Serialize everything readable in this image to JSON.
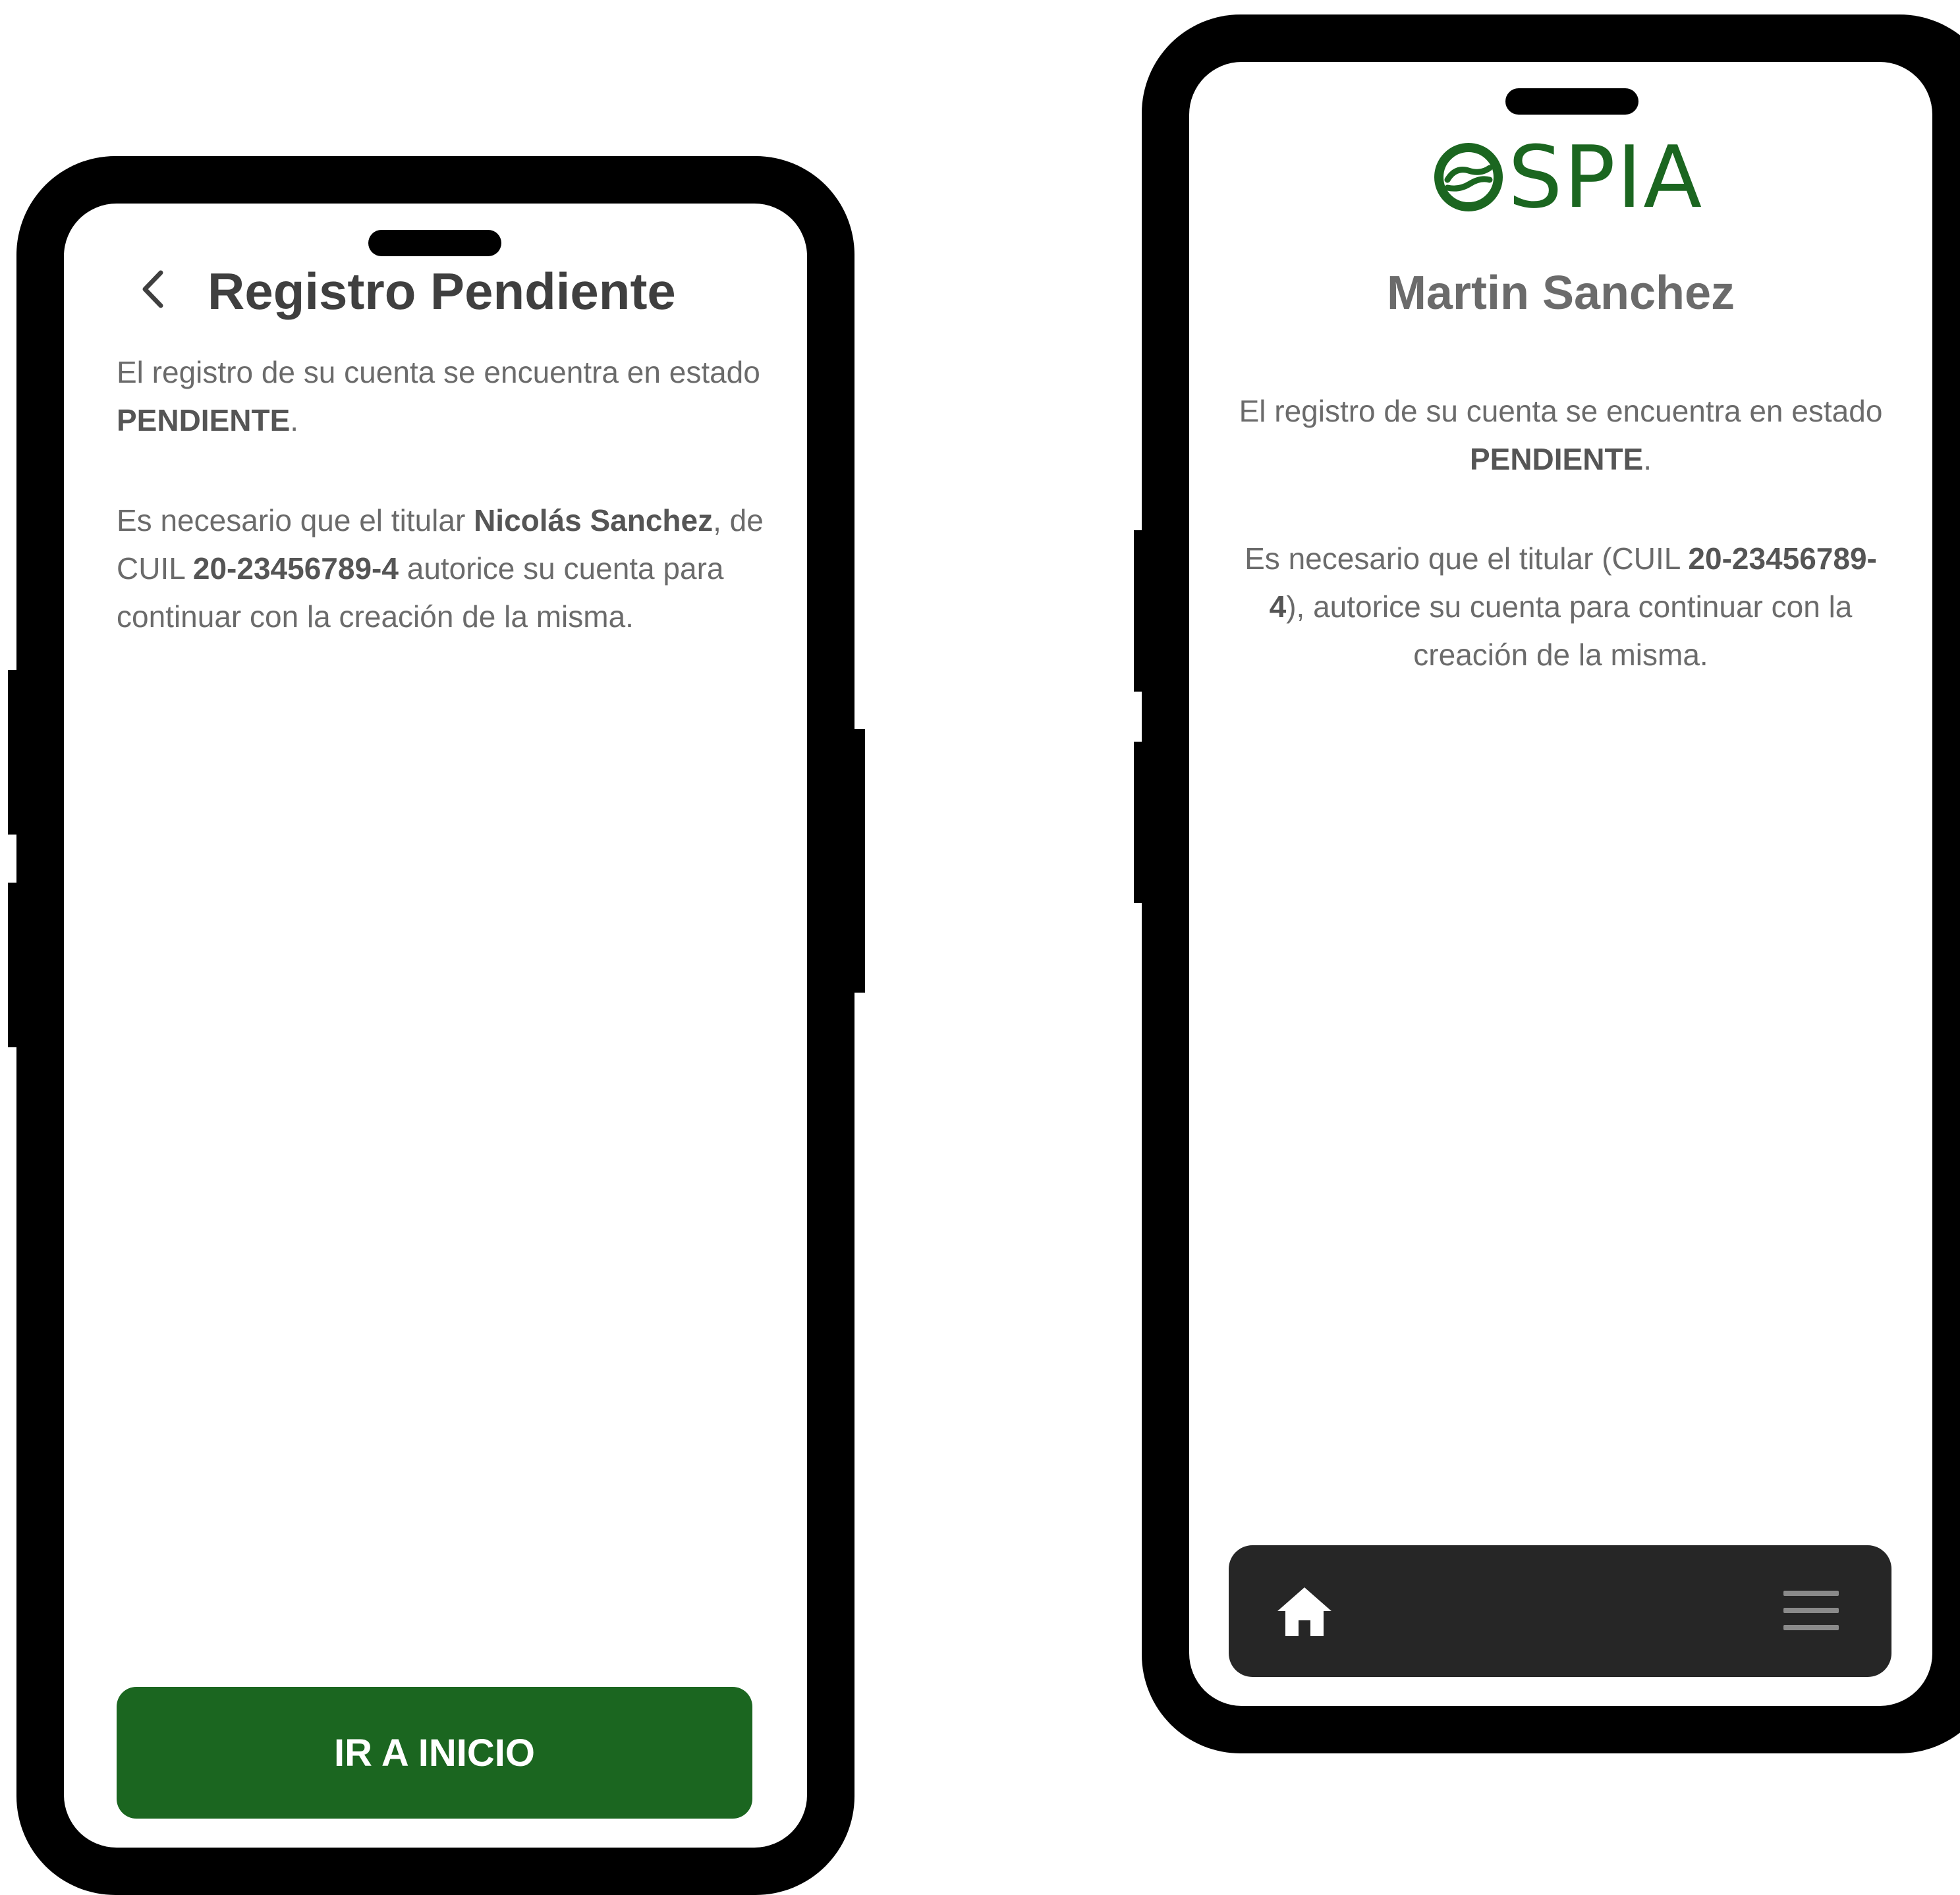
{
  "left_screen": {
    "header": {
      "title": "Registro Pendiente",
      "back_icon": "chevron-left-icon"
    },
    "status_message": {
      "prefix": "El registro de su cuenta se encuentra en estado ",
      "status": "PENDIENTE",
      "suffix": "."
    },
    "authorization_message": {
      "prefix": "Es necesario que el titular ",
      "holder_name": "Nicolás Sanchez",
      "middle": ", de CUIL ",
      "cuil": "20-23456789-4",
      "suffix": " autorice su cuenta para continuar con la creación de la misma."
    },
    "primary_button_label": "IR A INICIO"
  },
  "right_screen": {
    "logo_text": "SPIA",
    "user_name": "Martin Sanchez",
    "status_message": {
      "prefix": "El registro de su cuenta se encuentra en estado ",
      "status": "PENDIENTE",
      "suffix": "."
    },
    "authorization_message": {
      "prefix": "Es necesario que el titular (CUIL ",
      "cuil": "20-23456789-4",
      "suffix": "), autorice su cuenta para continuar con la creación de la misma."
    },
    "bottom_nav": {
      "home_icon": "home-icon",
      "menu_icon": "hamburger-menu-icon"
    }
  },
  "colors": {
    "brand_green": "#1b6620",
    "text_dark": "#3f3f3f",
    "text_body": "#6b6b6b",
    "nav_background": "#262626",
    "device_frame": "#000000"
  }
}
